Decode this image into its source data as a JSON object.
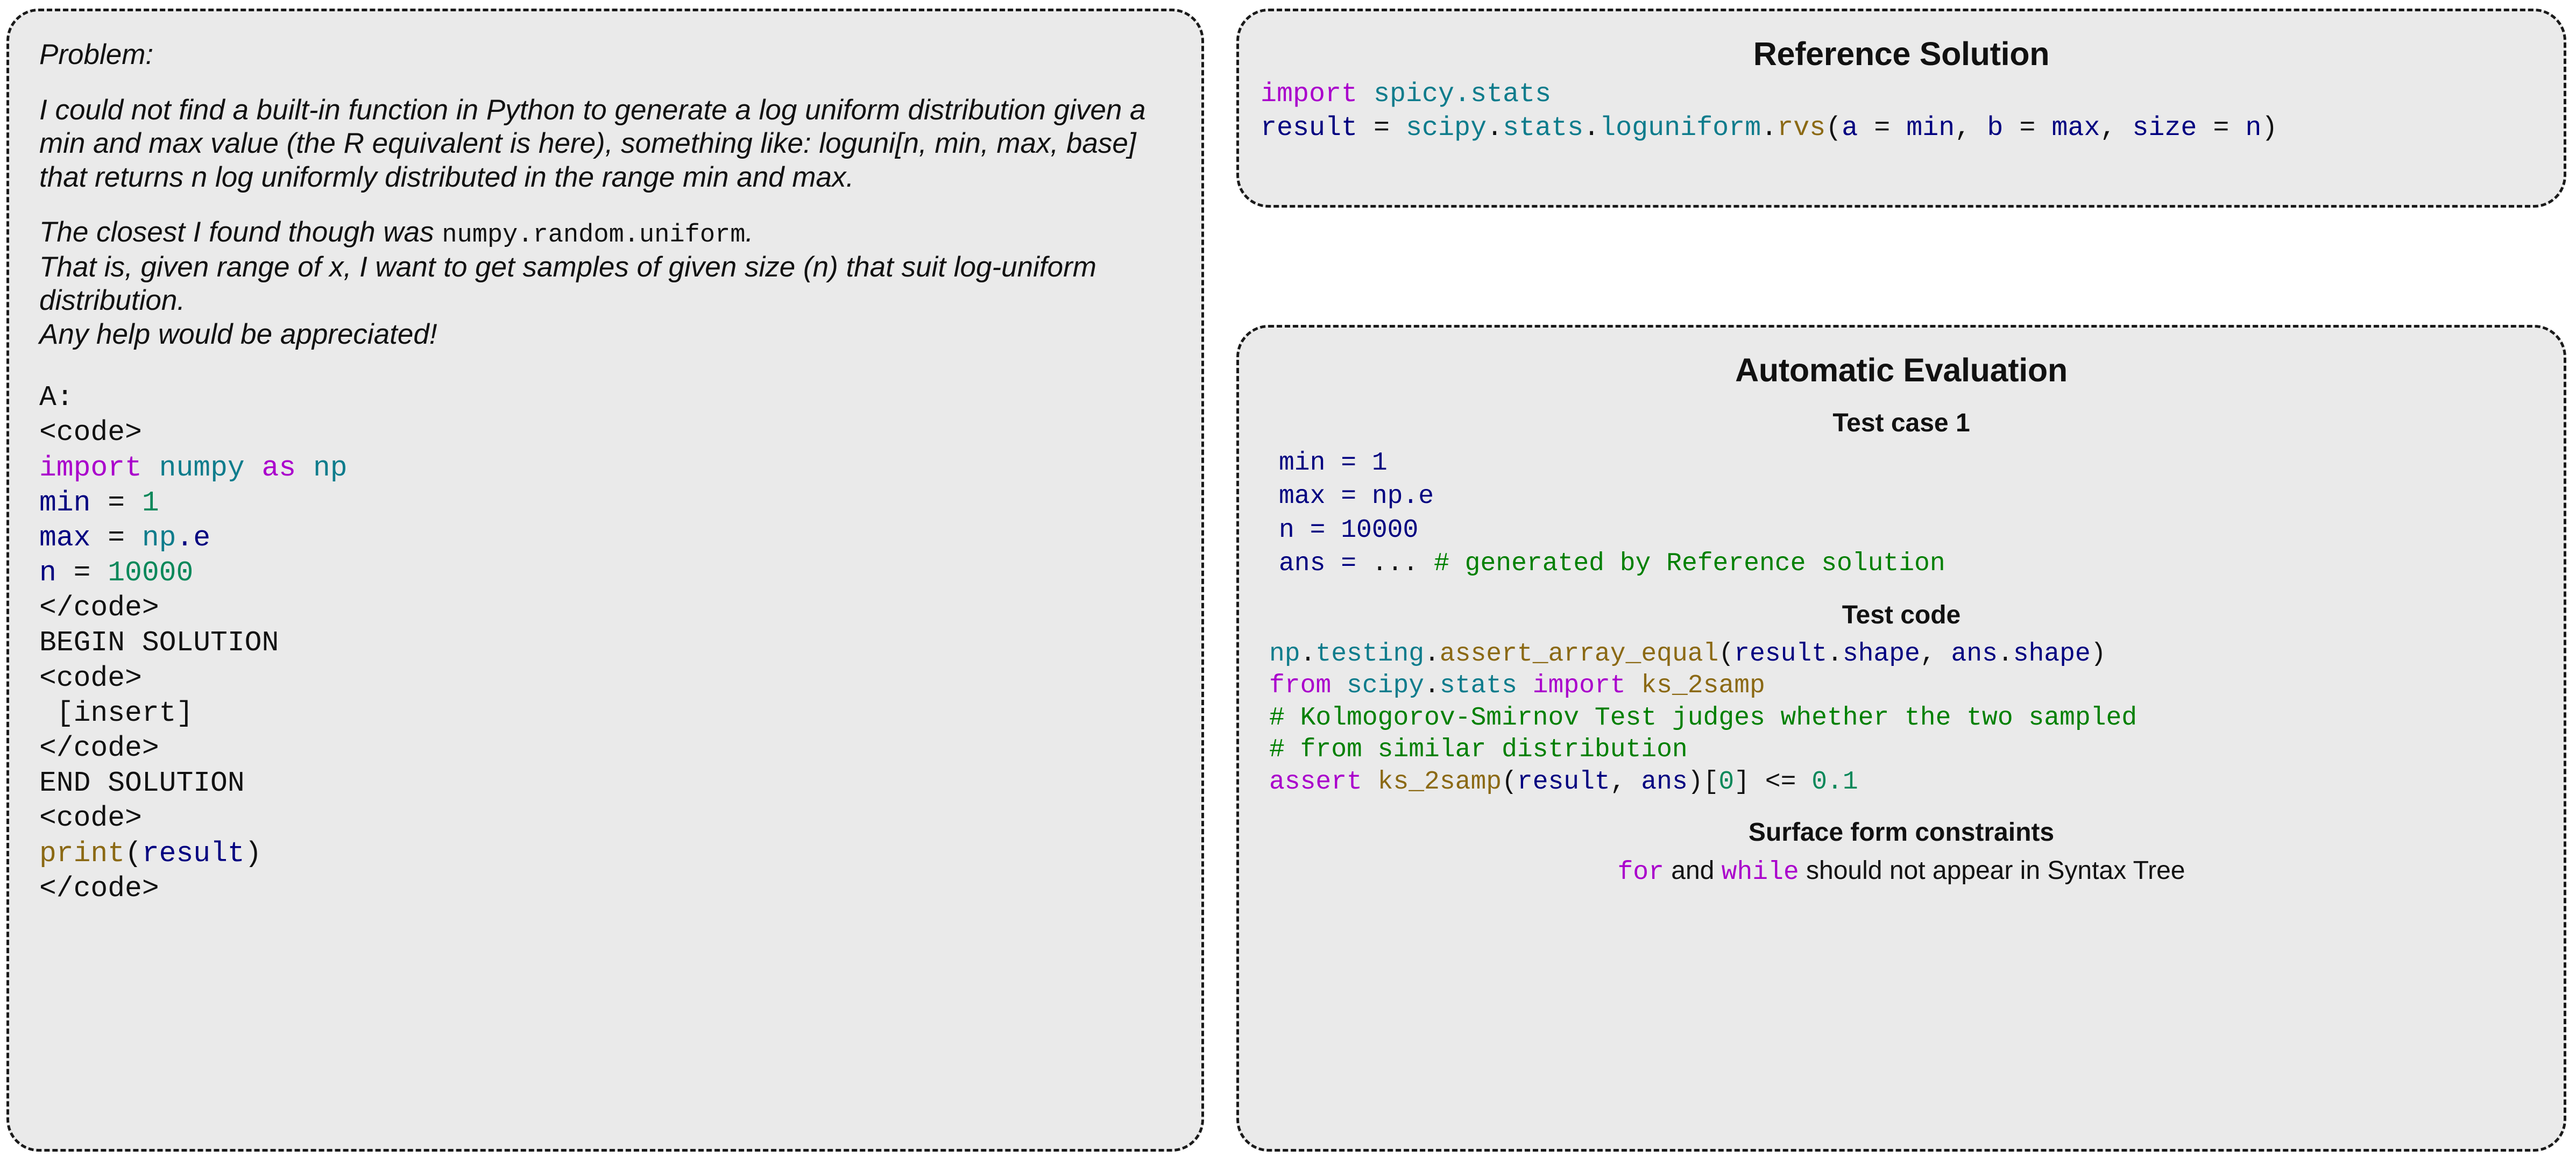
{
  "problem": {
    "heading": "Problem:",
    "paragraphs": [
      "I could not find a built-in function in Python to generate a log uniform distribution given a min and max value (the R equivalent is here), something like: loguni[n, min, max, base] that returns n log uniformly distributed in the range min and max.",
      "That is, given range of x, I want to get samples of given size (n) that suit log-uniform distribution.",
      "Any help would be appreciated!"
    ],
    "closest_prefix": "The closest I found though was ",
    "closest_code": "numpy.random.uniform",
    "closest_suffix": ".",
    "answer_label": "A:",
    "code_lines": {
      "open_tag_1": "<code>",
      "import_kw": "import",
      "import_mod": "numpy",
      "import_as": "as",
      "import_alias": "np",
      "min_var": "min",
      "min_eq": " = ",
      "min_val": "1",
      "max_var": "max",
      "max_eq": " = ",
      "max_val_mod": "np",
      "max_val_attr": ".e",
      "n_var": "n",
      "n_eq": " = ",
      "n_val": "10000",
      "close_tag_1": "</code>",
      "begin_solution": "BEGIN SOLUTION",
      "open_tag_2": "<code>",
      "insert": "[insert]",
      "close_tag_2": "</code>",
      "end_solution": "END SOLUTION",
      "open_tag_3": "<code>",
      "print_fn": "print",
      "print_open": "(",
      "print_arg": "result",
      "print_close": ")",
      "close_tag_3": "</code>"
    }
  },
  "reference": {
    "title": "Reference Solution",
    "line1_kw": "import",
    "line1_mod": " spicy.stats",
    "line2_var": "result",
    "line2_eq": " = ",
    "line2_mod": "scipy",
    "line2_dot1": ".",
    "line2_mod2": "stats",
    "line2_dot2": ".",
    "line2_mod3": "loguniform",
    "line2_dot3": ".",
    "line2_fn": "rvs",
    "line2_open": "(",
    "line2_a": "a",
    "line2_eq1": " = ",
    "line2_min": "min",
    "line2_c1": ", ",
    "line2_b": "b",
    "line2_eq2": " = ",
    "line2_max": "max",
    "line2_c2": ", ",
    "line2_size": "size",
    "line2_eq3": " = ",
    "line2_n": "n",
    "line2_close": ")"
  },
  "evaluation": {
    "title": "Automatic Evaluation",
    "testcase_title": "Test case 1",
    "testcase_lines": {
      "min_var": "min",
      "min_eq": " = ",
      "min_val": "1",
      "max_var": "max",
      "max_eq": " = ",
      "max_val": "np.e",
      "n_var": "n",
      "n_eq": " = ",
      "n_val": "10000",
      "ans_var": "ans",
      "ans_eq": " = ",
      "ans_val": "...",
      "ans_comment": " # generated by Reference solution"
    },
    "testcode_title": "Test code",
    "testcode_lines": {
      "l1_mod": "np",
      "l1_dot1": ".",
      "l1_mod2": "testing",
      "l1_dot2": ".",
      "l1_fn": "assert_array_equal",
      "l1_open": "(",
      "l1_a1": "result",
      "l1_d1": ".",
      "l1_a2": "shape",
      "l1_c": ", ",
      "l1_a3": "ans",
      "l1_d2": ".",
      "l1_a4": "shape",
      "l1_close": ")",
      "l2_from": "from",
      "l2_sp1": " ",
      "l2_mod": "scipy",
      "l2_dot": ".",
      "l2_mod2": "stats",
      "l2_sp2": " ",
      "l2_import": "import",
      "l2_sp3": " ",
      "l2_name": "ks_2samp",
      "l3_comment": "# Kolmogorov-Smirnov Test judges whether the two sampled",
      "l4_comment": "# from similar distribution",
      "l5_assert": "assert",
      "l5_sp": " ",
      "l5_fn": "ks_2samp",
      "l5_open": "(",
      "l5_a1": "result",
      "l5_c": ", ",
      "l5_a2": "ans",
      "l5_close": ")",
      "l5_idx_open": "[",
      "l5_idx": "0",
      "l5_idx_close": "]",
      "l5_op": " <= ",
      "l5_val": "0.1"
    },
    "constraints_title": "Surface form constraints",
    "constraint_kw1": "for",
    "constraint_mid": " and ",
    "constraint_kw2": "while",
    "constraint_tail": " should not appear in Syntax Tree"
  },
  "colors": {
    "panel_background": "#eaeaea",
    "panel_border": "#1a1a1a",
    "keyword": "#AA00CC",
    "module": "#0E7C8C",
    "identifier": "#000080",
    "number": "#09885A",
    "function": "#8B6914",
    "comment": "#008000",
    "text": "#111111"
  }
}
